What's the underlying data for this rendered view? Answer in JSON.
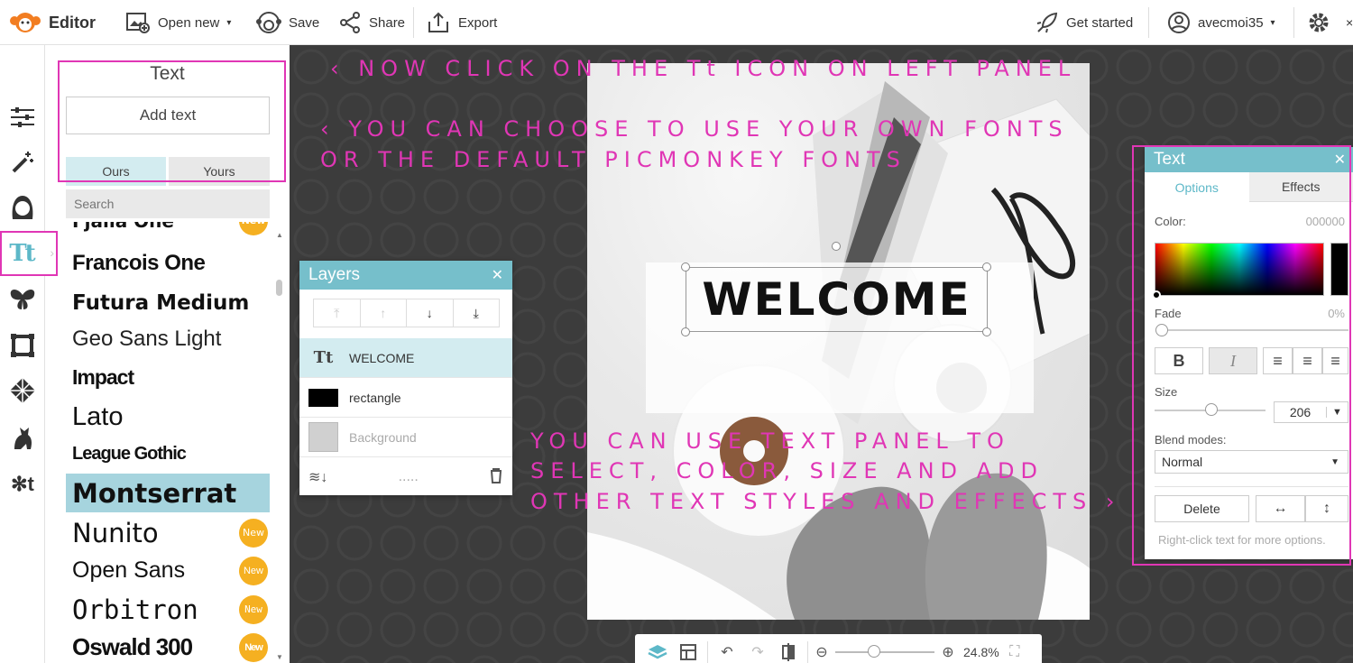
{
  "topbar": {
    "app_name": "Editor",
    "open_new": "Open new",
    "save": "Save",
    "share": "Share",
    "export": "Export",
    "get_started": "Get started",
    "username": "avecmoi35"
  },
  "text_panel": {
    "title": "Text",
    "add_text": "Add text",
    "tab_ours": "Ours",
    "tab_yours": "Yours",
    "search_placeholder": "Search",
    "fonts": [
      {
        "name": "Fjalla One",
        "new": true
      },
      {
        "name": "Francois One",
        "new": false
      },
      {
        "name": "Futura Medium",
        "new": false
      },
      {
        "name": "Geo Sans Light",
        "new": false
      },
      {
        "name": "Impact",
        "new": false
      },
      {
        "name": "Lato",
        "new": false
      },
      {
        "name": "League Gothic",
        "new": false
      },
      {
        "name": "Montserrat",
        "new": false,
        "selected": true
      },
      {
        "name": "Nunito",
        "new": true
      },
      {
        "name": "Open Sans",
        "new": true
      },
      {
        "name": "Orbitron",
        "new": true
      },
      {
        "name": "Oswald 300",
        "new": true
      }
    ],
    "new_badge": "New"
  },
  "annotations": {
    "line1": "‹ NOW CLICK ON THE Tt ICON ON LEFT PANEL",
    "line2": "‹ YOU CAN CHOOSE TO USE YOUR OWN FONTS",
    "line3": "OR THE DEFAULT PICMONKEY FONTS",
    "line4": "YOU CAN USE TEXT PANEL TO",
    "line5": "SELECT, COLOR, SIZE AND ADD",
    "line6": "OTHER TEXT STYLES AND EFFECTS ›",
    "color": "#e036b5"
  },
  "canvas": {
    "welcome_text": "WELCOME"
  },
  "layers": {
    "title": "Layers",
    "items": [
      {
        "label": "WELCOME",
        "icon": "Tt",
        "selected": true
      },
      {
        "label": "rectangle",
        "icon": "rect",
        "selected": false
      },
      {
        "label": "Background",
        "icon": "image",
        "selected": false
      }
    ],
    "footer_dots": "....."
  },
  "text_options": {
    "title": "Text",
    "tab_options": "Options",
    "tab_effects": "Effects",
    "color_label": "Color:",
    "color_value": "000000",
    "fade_label": "Fade",
    "fade_value": "0%",
    "fade": 0,
    "bold": "B",
    "italic": "I",
    "size_label": "Size",
    "size_value": "206",
    "blend_label": "Blend modes:",
    "blend_value": "Normal",
    "delete": "Delete",
    "hint": "Right-click text for more options."
  },
  "bottombar": {
    "zoom": "24.8%"
  },
  "colors": {
    "accent": "#76bfcb",
    "highlight": "#e036b5",
    "new_badge": "#f5b021"
  }
}
